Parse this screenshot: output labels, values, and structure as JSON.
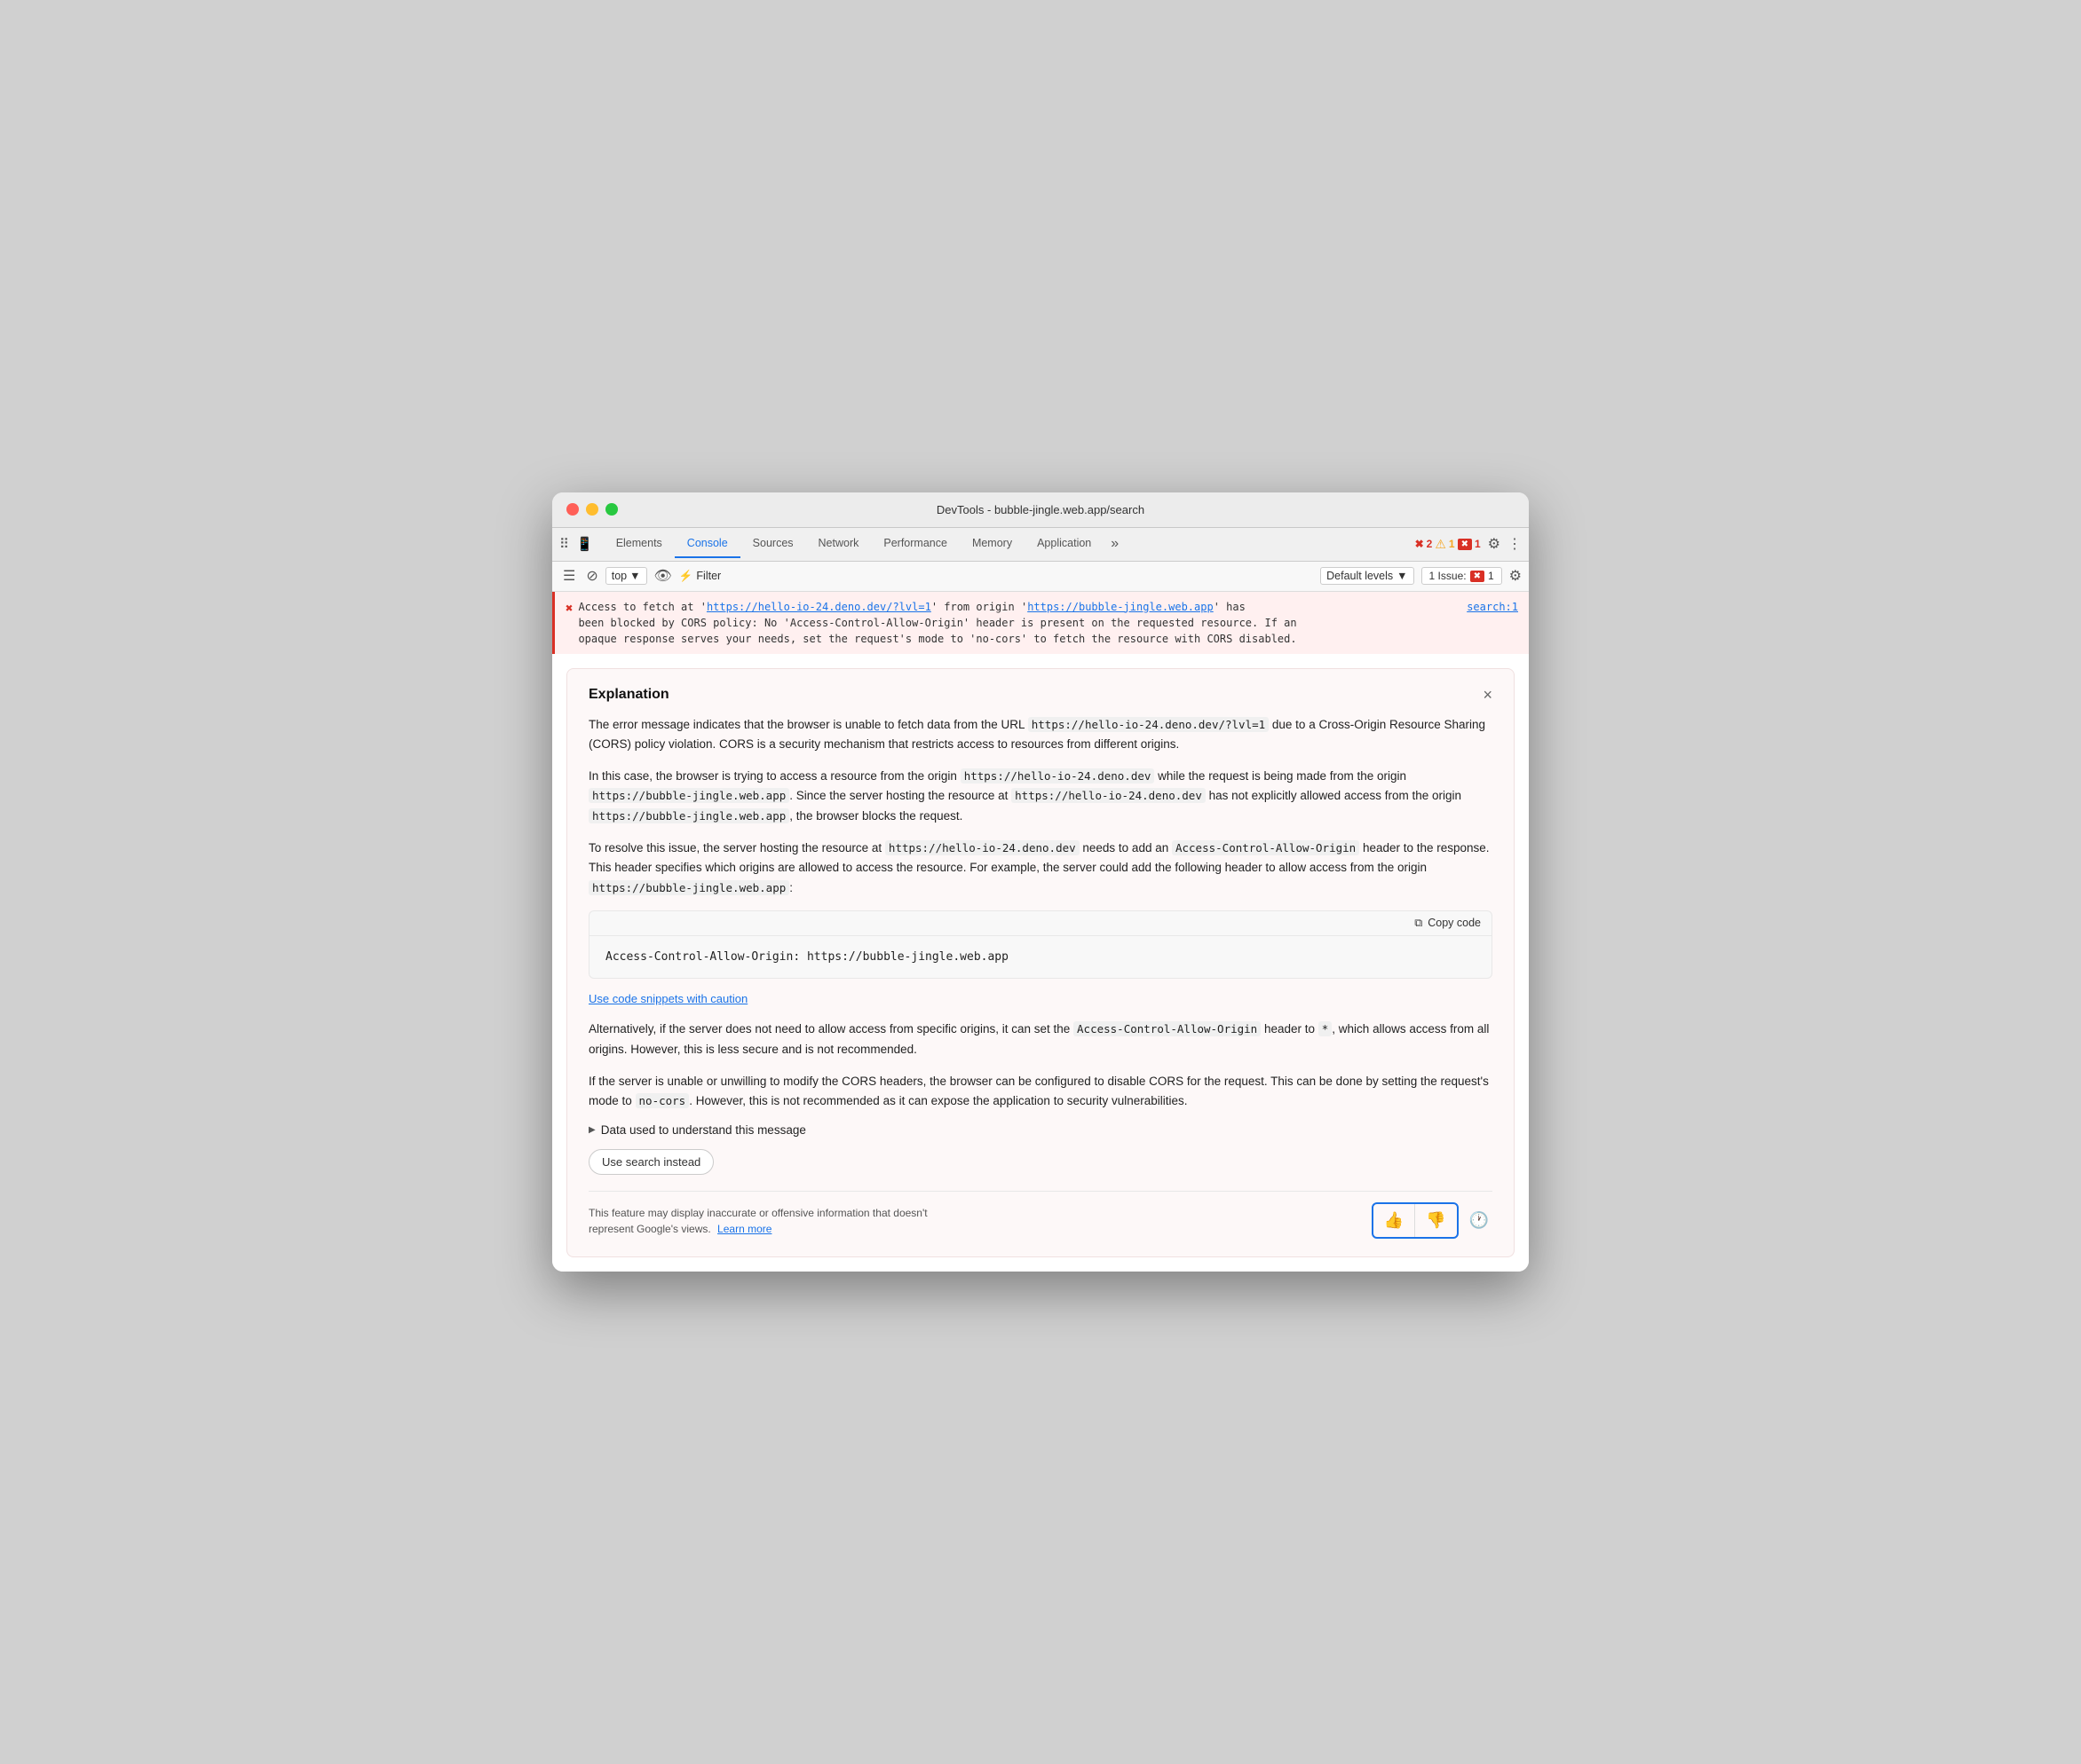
{
  "window": {
    "title": "DevTools - bubble-jingle.web.app/search"
  },
  "tabs": {
    "items": [
      {
        "id": "elements",
        "label": "Elements",
        "active": false
      },
      {
        "id": "console",
        "label": "Console",
        "active": true
      },
      {
        "id": "sources",
        "label": "Sources",
        "active": false
      },
      {
        "id": "network",
        "label": "Network",
        "active": false
      },
      {
        "id": "performance",
        "label": "Performance",
        "active": false
      },
      {
        "id": "memory",
        "label": "Memory",
        "active": false
      },
      {
        "id": "application",
        "label": "Application",
        "active": false
      }
    ],
    "more_label": "»",
    "error_count": "2",
    "warning_count": "1",
    "issue_count": "1"
  },
  "toolbar": {
    "top_label": "top",
    "filter_label": "Filter",
    "default_levels_label": "Default levels",
    "issue_label": "1 Issue:",
    "issue_count": "1"
  },
  "error_line": {
    "icon": "✖",
    "text_part1": "Access to fetch at '",
    "link1": "https://hello-io-24.deno.dev/?lvl=1",
    "text_part2": "' from origin '",
    "link2": "https://bubble-jingle.web.app",
    "text_part3": "' has",
    "text_part4": "been blocked by CORS policy: No 'Access-Control-Allow-Origin' header is present on the requested resource. If an",
    "text_part5": "opaque response serves your needs, set the request's mode to 'no-cors' to fetch the resource with CORS disabled.",
    "source": "search:1"
  },
  "explanation": {
    "title": "Explanation",
    "close_icon": "×",
    "paragraphs": [
      "The error message indicates that the browser is unable to fetch data from the URL https://hello-io-24.deno.dev/?lvl=1 due to a Cross-Origin Resource Sharing (CORS) policy violation. CORS is a security mechanism that restricts access to resources from different origins.",
      "In this case, the browser is trying to access a resource from the origin https://hello-io-24.deno.dev while the request is being made from the origin https://bubble-jingle.web.app. Since the server hosting the resource at https://hello-io-24.deno.dev has not explicitly allowed access from the origin https://bubble-jingle.web.app, the browser blocks the request.",
      "To resolve this issue, the server hosting the resource at https://hello-io-24.deno.dev needs to add an Access-Control-Allow-Origin header to the response. This header specifies which origins are allowed to access the resource. For example, the server could add the following header to allow access from the origin https://bubble-jingle.web.app:"
    ],
    "code_block": {
      "copy_label": "Copy code",
      "code": "Access-Control-Allow-Origin: https://bubble-jingle.web.app"
    },
    "caution_link": "Use code snippets with caution",
    "paragraph_after": "Alternatively, if the server does not need to allow access from specific origins, it can set the Access-Control-Allow-Origin header to *, which allows access from all origins. However, this is less secure and is not recommended.",
    "paragraph_last": "If the server is unable or unwilling to modify the CORS headers, the browser can be configured to disable CORS for the request. This can be done by setting the request's mode to no-cors. However, this is not recommended as it can expose the application to security vulnerabilities.",
    "data_used_label": "Data used to understand this message",
    "use_search_label": "Use search instead",
    "disclaimer": "This feature may display inaccurate or offensive information that doesn't represent Google's views.",
    "learn_more": "Learn more",
    "thumbs_up": "👍",
    "thumbs_down": "👎",
    "info_icon": "🕐"
  }
}
